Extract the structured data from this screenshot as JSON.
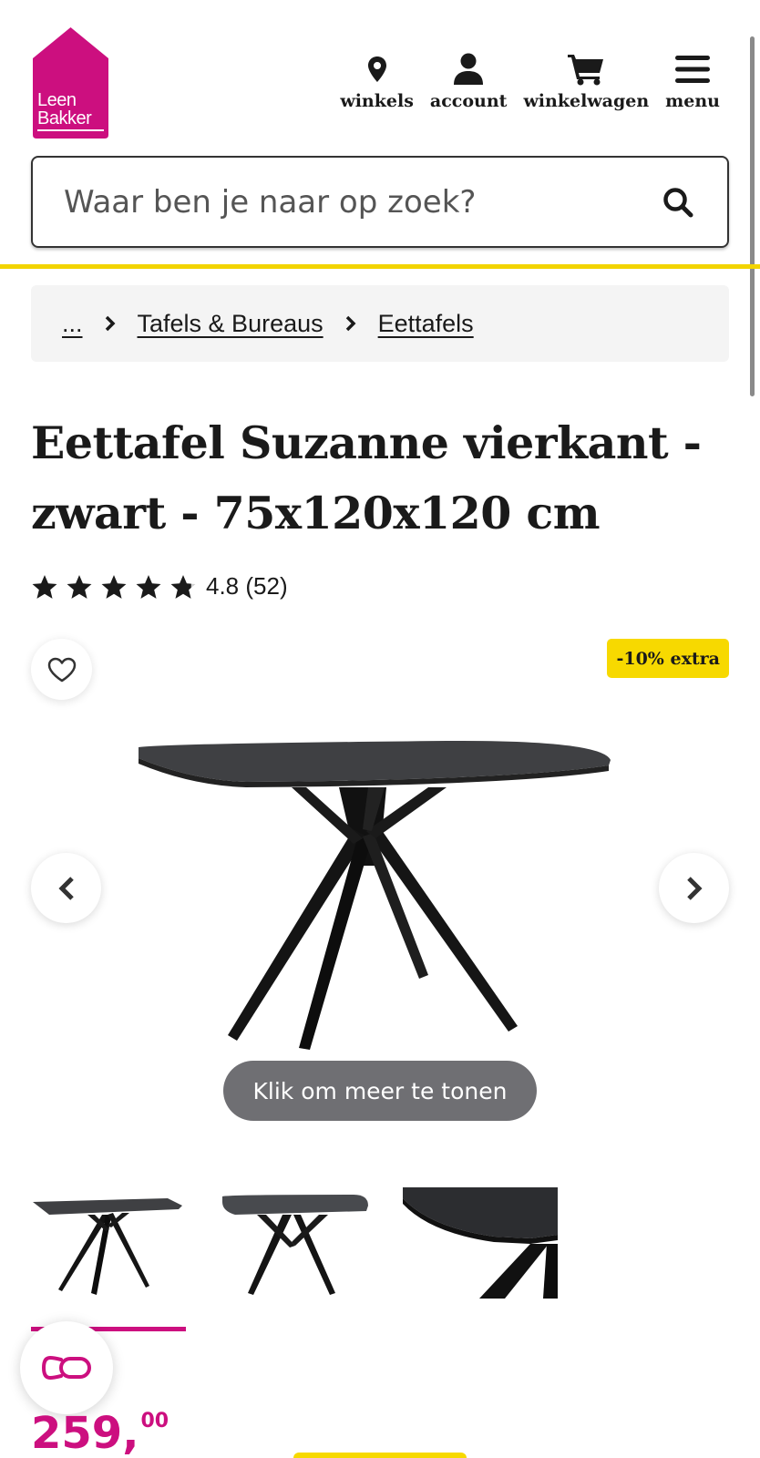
{
  "brand": {
    "logo_line1": "Leen",
    "logo_line2": "Bakker",
    "color": "#cc0f7f"
  },
  "nav": [
    {
      "label": "winkels",
      "icon": "location-pin-icon"
    },
    {
      "label": "account",
      "icon": "user-icon"
    },
    {
      "label": "winkelwagen",
      "icon": "shopping-cart-icon"
    },
    {
      "label": "menu",
      "icon": "hamburger-menu-icon"
    }
  ],
  "search": {
    "placeholder": "Waar ben je naar op zoek?"
  },
  "breadcrumb": {
    "ellipsis": "...",
    "items": [
      "Tafels & Bureaus",
      "Eettafels"
    ]
  },
  "product": {
    "title": "Eettafel Suzanne vierkant - zwart - 75x120x120 cm",
    "rating": {
      "stars": 4.8,
      "max": 5,
      "text": "4.8 (52)"
    },
    "badge": "-10% extra",
    "show_more": "Klik om meer te tonen",
    "price_main": "259,",
    "price_cents": "00"
  },
  "colors": {
    "accent": "#cc0f7f",
    "highlight": "#f7d900",
    "text": "#1a1a1a"
  }
}
